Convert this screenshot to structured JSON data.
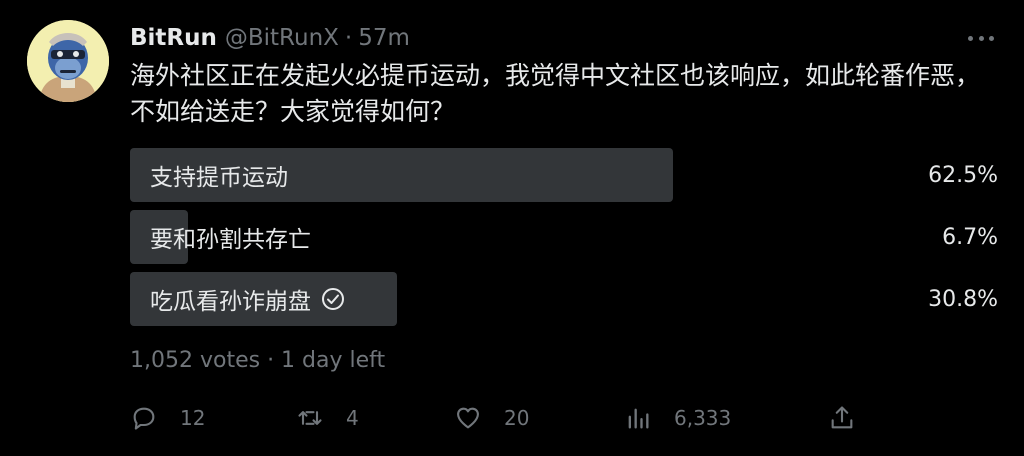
{
  "tweet": {
    "author_name": "BitRun",
    "handle": "@BitRunX",
    "separator": "·",
    "time": "57m",
    "text": "海外社区正在发起火必提币运动，我觉得中文社区也该响应，如此轮番作恶，不如给送走？大家觉得如何？"
  },
  "poll": {
    "options": [
      {
        "label": "支持提币运动",
        "percent": "62.5%",
        "share": 62.5,
        "selected": false
      },
      {
        "label": "要和孙割共存亡",
        "percent": "6.7%",
        "share": 6.7,
        "selected": false
      },
      {
        "label": "吃瓜看孙诈崩盘",
        "percent": "30.8%",
        "share": 30.8,
        "selected": true
      }
    ],
    "meta": "1,052 votes · 1 day left"
  },
  "actions": {
    "replies": "12",
    "retweets": "4",
    "likes": "20",
    "views": "6,333"
  },
  "icons": {
    "more": "more-dots-icon",
    "check": "check-circle-icon",
    "reply": "reply-icon",
    "retweet": "retweet-icon",
    "like": "heart-icon",
    "views": "views-chart-icon",
    "share": "share-icon"
  },
  "colors": {
    "background": "#000000",
    "text": "#e7e9ea",
    "muted": "#71767b",
    "poll_bar": "#333639"
  }
}
